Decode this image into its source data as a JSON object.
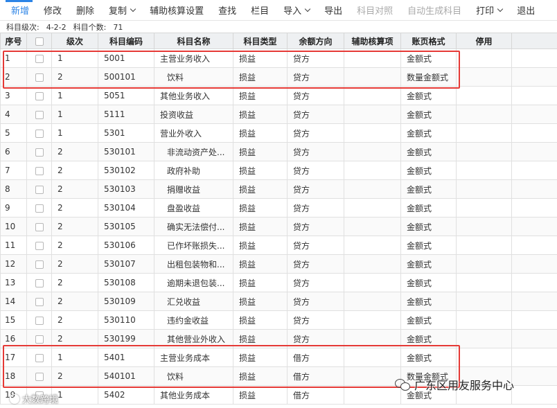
{
  "toolbar": {
    "items": [
      {
        "label": "新增",
        "state": "active",
        "dropdown": false
      },
      {
        "label": "修改",
        "state": "normal",
        "dropdown": false
      },
      {
        "label": "删除",
        "state": "normal",
        "dropdown": false
      },
      {
        "label": "复制",
        "state": "normal",
        "dropdown": true
      },
      {
        "label": "辅助核算设置",
        "state": "normal",
        "dropdown": false
      },
      {
        "label": "查找",
        "state": "normal",
        "dropdown": false
      },
      {
        "label": "栏目",
        "state": "normal",
        "dropdown": false
      },
      {
        "label": "导入",
        "state": "normal",
        "dropdown": true
      },
      {
        "label": "导出",
        "state": "normal",
        "dropdown": false
      },
      {
        "label": "科目对照",
        "state": "disabled",
        "dropdown": false
      },
      {
        "label": "自动生成科目",
        "state": "disabled",
        "dropdown": false
      },
      {
        "label": "打印",
        "state": "normal",
        "dropdown": true
      },
      {
        "label": "退出",
        "state": "normal",
        "dropdown": false
      }
    ]
  },
  "summary": {
    "level_label": "科目级次:",
    "level_value": "4-2-2",
    "count_label": "科目个数:",
    "count_value": "71"
  },
  "table": {
    "headers": [
      "序号",
      "",
      "级次",
      "科目编码",
      "科目名称",
      "科目类型",
      "余额方向",
      "辅助核算项",
      "账页格式",
      "停用"
    ],
    "rows": [
      [
        "1",
        "1",
        "5001",
        "主营业务收入",
        "损益",
        "贷方",
        "",
        "金额式",
        ""
      ],
      [
        "2",
        "2",
        "500101",
        "饮料",
        "损益",
        "贷方",
        "",
        "数量金额式",
        ""
      ],
      [
        "3",
        "1",
        "5051",
        "其他业务收入",
        "损益",
        "贷方",
        "",
        "金额式",
        ""
      ],
      [
        "4",
        "1",
        "5111",
        "投资收益",
        "损益",
        "贷方",
        "",
        "金额式",
        ""
      ],
      [
        "5",
        "1",
        "5301",
        "营业外收入",
        "损益",
        "贷方",
        "",
        "金额式",
        ""
      ],
      [
        "6",
        "2",
        "530101",
        "非流动资产处...",
        "损益",
        "贷方",
        "",
        "金额式",
        ""
      ],
      [
        "7",
        "2",
        "530102",
        "政府补助",
        "损益",
        "贷方",
        "",
        "金额式",
        ""
      ],
      [
        "8",
        "2",
        "530103",
        "捐赠收益",
        "损益",
        "贷方",
        "",
        "金额式",
        ""
      ],
      [
        "9",
        "2",
        "530104",
        "盘盈收益",
        "损益",
        "贷方",
        "",
        "金额式",
        ""
      ],
      [
        "10",
        "2",
        "530105",
        "确实无法偿付...",
        "损益",
        "贷方",
        "",
        "金额式",
        ""
      ],
      [
        "11",
        "2",
        "530106",
        "已作坏账损失...",
        "损益",
        "贷方",
        "",
        "金额式",
        ""
      ],
      [
        "12",
        "2",
        "530107",
        "出租包装物和...",
        "损益",
        "贷方",
        "",
        "金额式",
        ""
      ],
      [
        "13",
        "2",
        "530108",
        "逾期未退包装...",
        "损益",
        "贷方",
        "",
        "金额式",
        ""
      ],
      [
        "14",
        "2",
        "530109",
        "汇兑收益",
        "损益",
        "贷方",
        "",
        "金额式",
        ""
      ],
      [
        "15",
        "2",
        "530110",
        "违约金收益",
        "损益",
        "贷方",
        "",
        "金额式",
        ""
      ],
      [
        "16",
        "2",
        "530199",
        "其他营业外收入",
        "损益",
        "贷方",
        "",
        "金额式",
        ""
      ],
      [
        "17",
        "1",
        "5401",
        "主营业务成本",
        "损益",
        "借方",
        "",
        "金额式",
        ""
      ],
      [
        "18",
        "2",
        "540101",
        "饮料",
        "损益",
        "借方",
        "",
        "数量金额式",
        ""
      ],
      [
        "19",
        "1",
        "5402",
        "其他业务成本",
        "损益",
        "借方",
        "",
        "金额式",
        ""
      ]
    ]
  },
  "watermarks": {
    "right": "广东区用友服务中心",
    "left": "大数跨境"
  },
  "colors": {
    "accent": "#2c84e6",
    "highlight": "#e53935",
    "header_bg": "#eef0f2"
  }
}
